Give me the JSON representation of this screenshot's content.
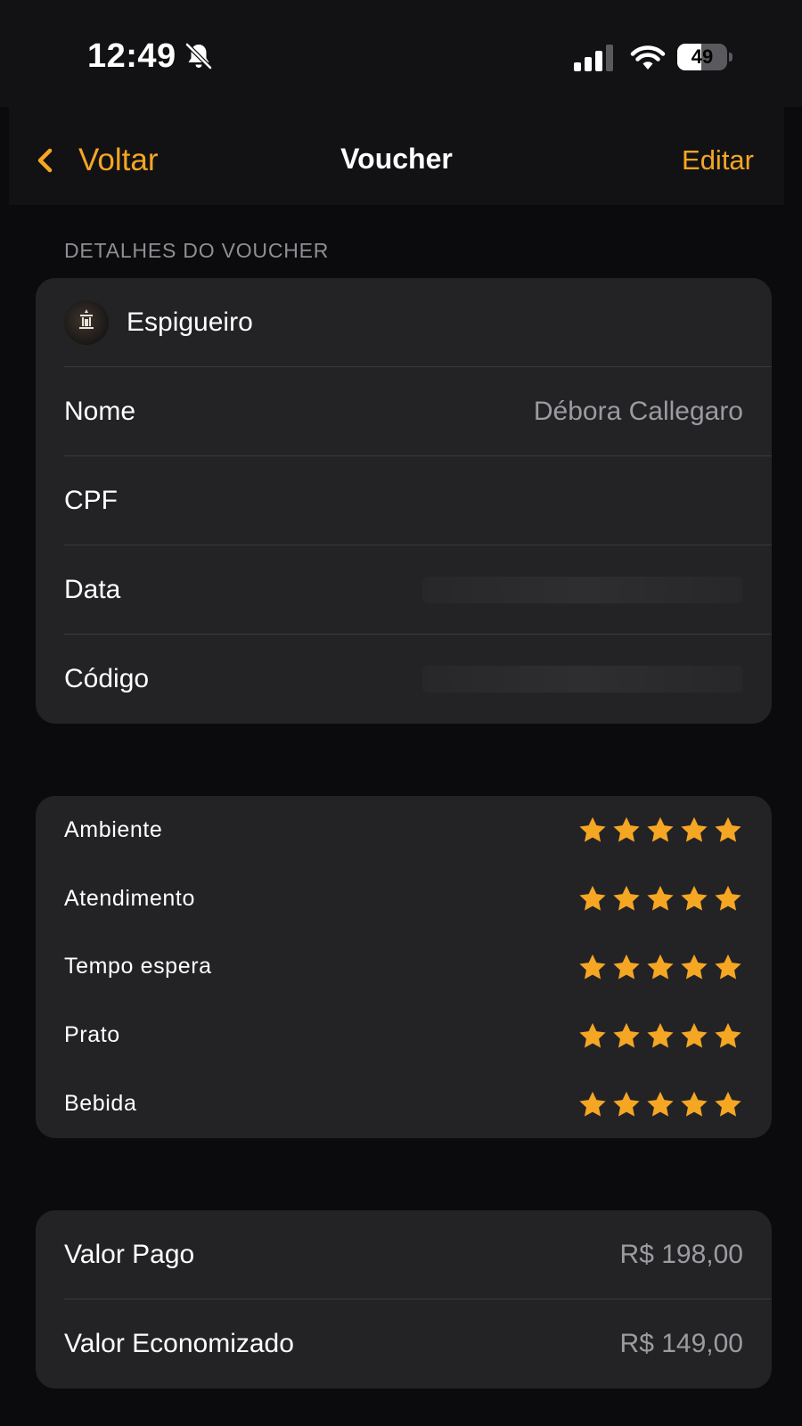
{
  "status_bar": {
    "time": "12:49",
    "battery": "49",
    "battery_level": 0.49,
    "icons": [
      "bell-slash-icon",
      "cellular-signal-icon",
      "wifi-icon",
      "battery-icon"
    ]
  },
  "nav": {
    "back_label": "Voltar",
    "title": "Voucher",
    "edit_label": "Editar"
  },
  "details": {
    "section_header": "DETALHES DO VOUCHER",
    "restaurant": "Espigueiro",
    "rows": [
      {
        "label": "Nome",
        "value": "Débora Callegaro"
      },
      {
        "label": "CPF",
        "value": ""
      },
      {
        "label": "Data",
        "value": ""
      },
      {
        "label": "Código",
        "value": ""
      }
    ]
  },
  "ratings": [
    {
      "label": "Ambiente",
      "stars": 5,
      "max": 5
    },
    {
      "label": "Atendimento",
      "stars": 5,
      "max": 5
    },
    {
      "label": "Tempo espera",
      "stars": 5,
      "max": 5
    },
    {
      "label": "Prato",
      "stars": 5,
      "max": 5
    },
    {
      "label": "Bebida",
      "stars": 5,
      "max": 5
    }
  ],
  "values": {
    "paid_label": "Valor Pago",
    "paid_value": "R$ 198,00",
    "saved_label": "Valor Economizado",
    "saved_value": "R$ 149,00"
  },
  "colors": {
    "accent": "#f5a623",
    "background": "#0b0b0d",
    "card": "#232326",
    "secondary_text": "#9b9ba0"
  }
}
